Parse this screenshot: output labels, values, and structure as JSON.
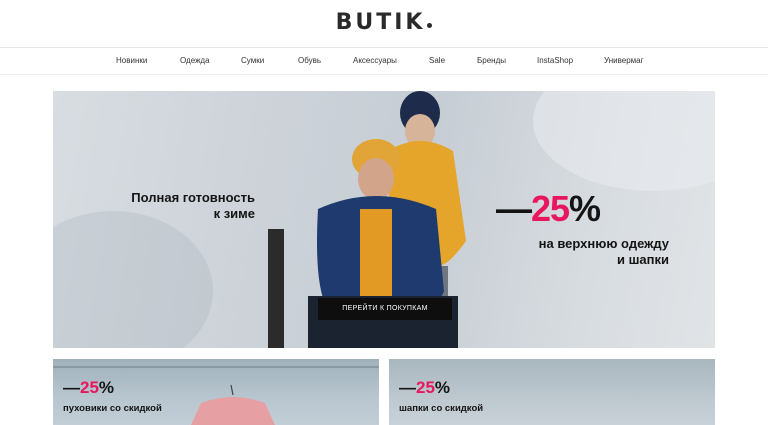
{
  "brand": {
    "logo": "BUTIK"
  },
  "nav": {
    "items": [
      {
        "label": "Новинки"
      },
      {
        "label": "Одежда"
      },
      {
        "label": "Сумки"
      },
      {
        "label": "Обувь"
      },
      {
        "label": "Аксессуары"
      },
      {
        "label": "Sale"
      },
      {
        "label": "Бренды"
      },
      {
        "label": "InstaShop"
      },
      {
        "label": "Универмаг"
      }
    ]
  },
  "hero": {
    "title_line1": "Полная готовность",
    "title_line2": "к зиме",
    "discount_dash": "—",
    "discount_number": "25",
    "discount_percent": "%",
    "subtitle_line1": "на верхнюю одежду",
    "subtitle_line2": "и шапки",
    "button_label": "ПЕРЕЙТИ К ПОКУПКАМ"
  },
  "promos": [
    {
      "dash": "—",
      "number": "25",
      "percent": "%",
      "subtitle": "пуховики со скидкой"
    },
    {
      "dash": "—",
      "number": "25",
      "percent": "%",
      "subtitle": "шапки со скидкой"
    }
  ],
  "colors": {
    "accent": "#e8175d",
    "text": "#141414",
    "button_bg": "#0e0e0e"
  }
}
